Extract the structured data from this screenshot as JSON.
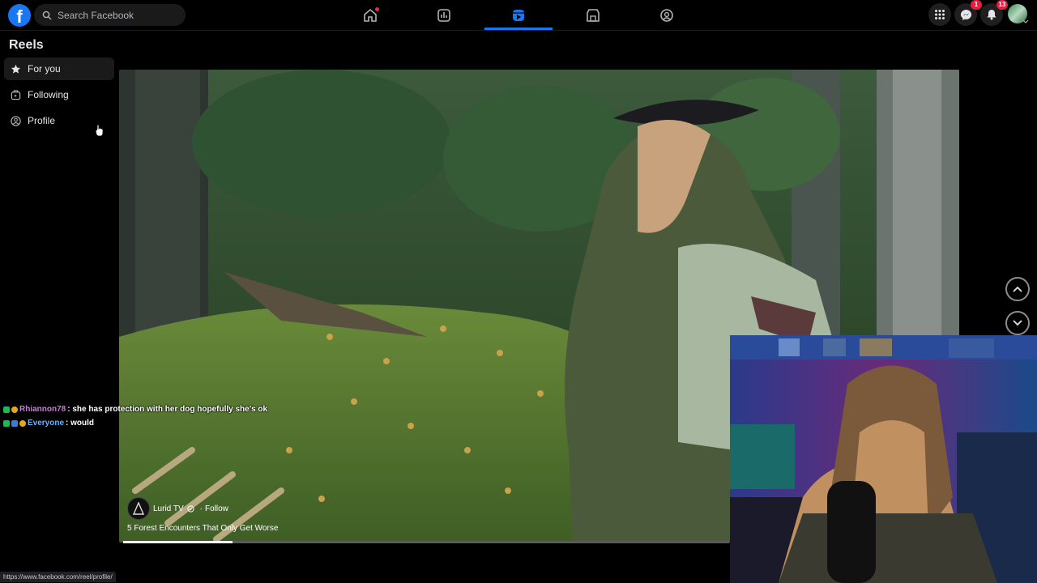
{
  "topbar": {
    "logo": "f",
    "search_placeholder": "Search Facebook",
    "nav": [
      "home-icon",
      "video-icon",
      "reels-icon",
      "marketplace-icon",
      "groups-icon"
    ],
    "messenger_badge": "1",
    "notifications_badge": "13"
  },
  "sidebar": {
    "title": "Reels",
    "items": [
      {
        "label": "For you",
        "icon": "star-icon"
      },
      {
        "label": "Following",
        "icon": "following-icon"
      },
      {
        "label": "Profile",
        "icon": "profile-icon"
      }
    ]
  },
  "reel": {
    "creator": "Lurid TV",
    "follow": "Follow",
    "separator": "·",
    "caption": "5 Forest Encounters That Only Get Worse",
    "progress": 0.18
  },
  "chat": [
    {
      "user": "Rhiannon78",
      "message": ": she has protection with her dog hopefully she's ok"
    },
    {
      "user": "Everyone",
      "message": ": would"
    }
  ],
  "status_url": "https://www.facebook.com/reel/profile/",
  "colors": {
    "accent": "#1877f2",
    "badge": "#e41e3f"
  }
}
